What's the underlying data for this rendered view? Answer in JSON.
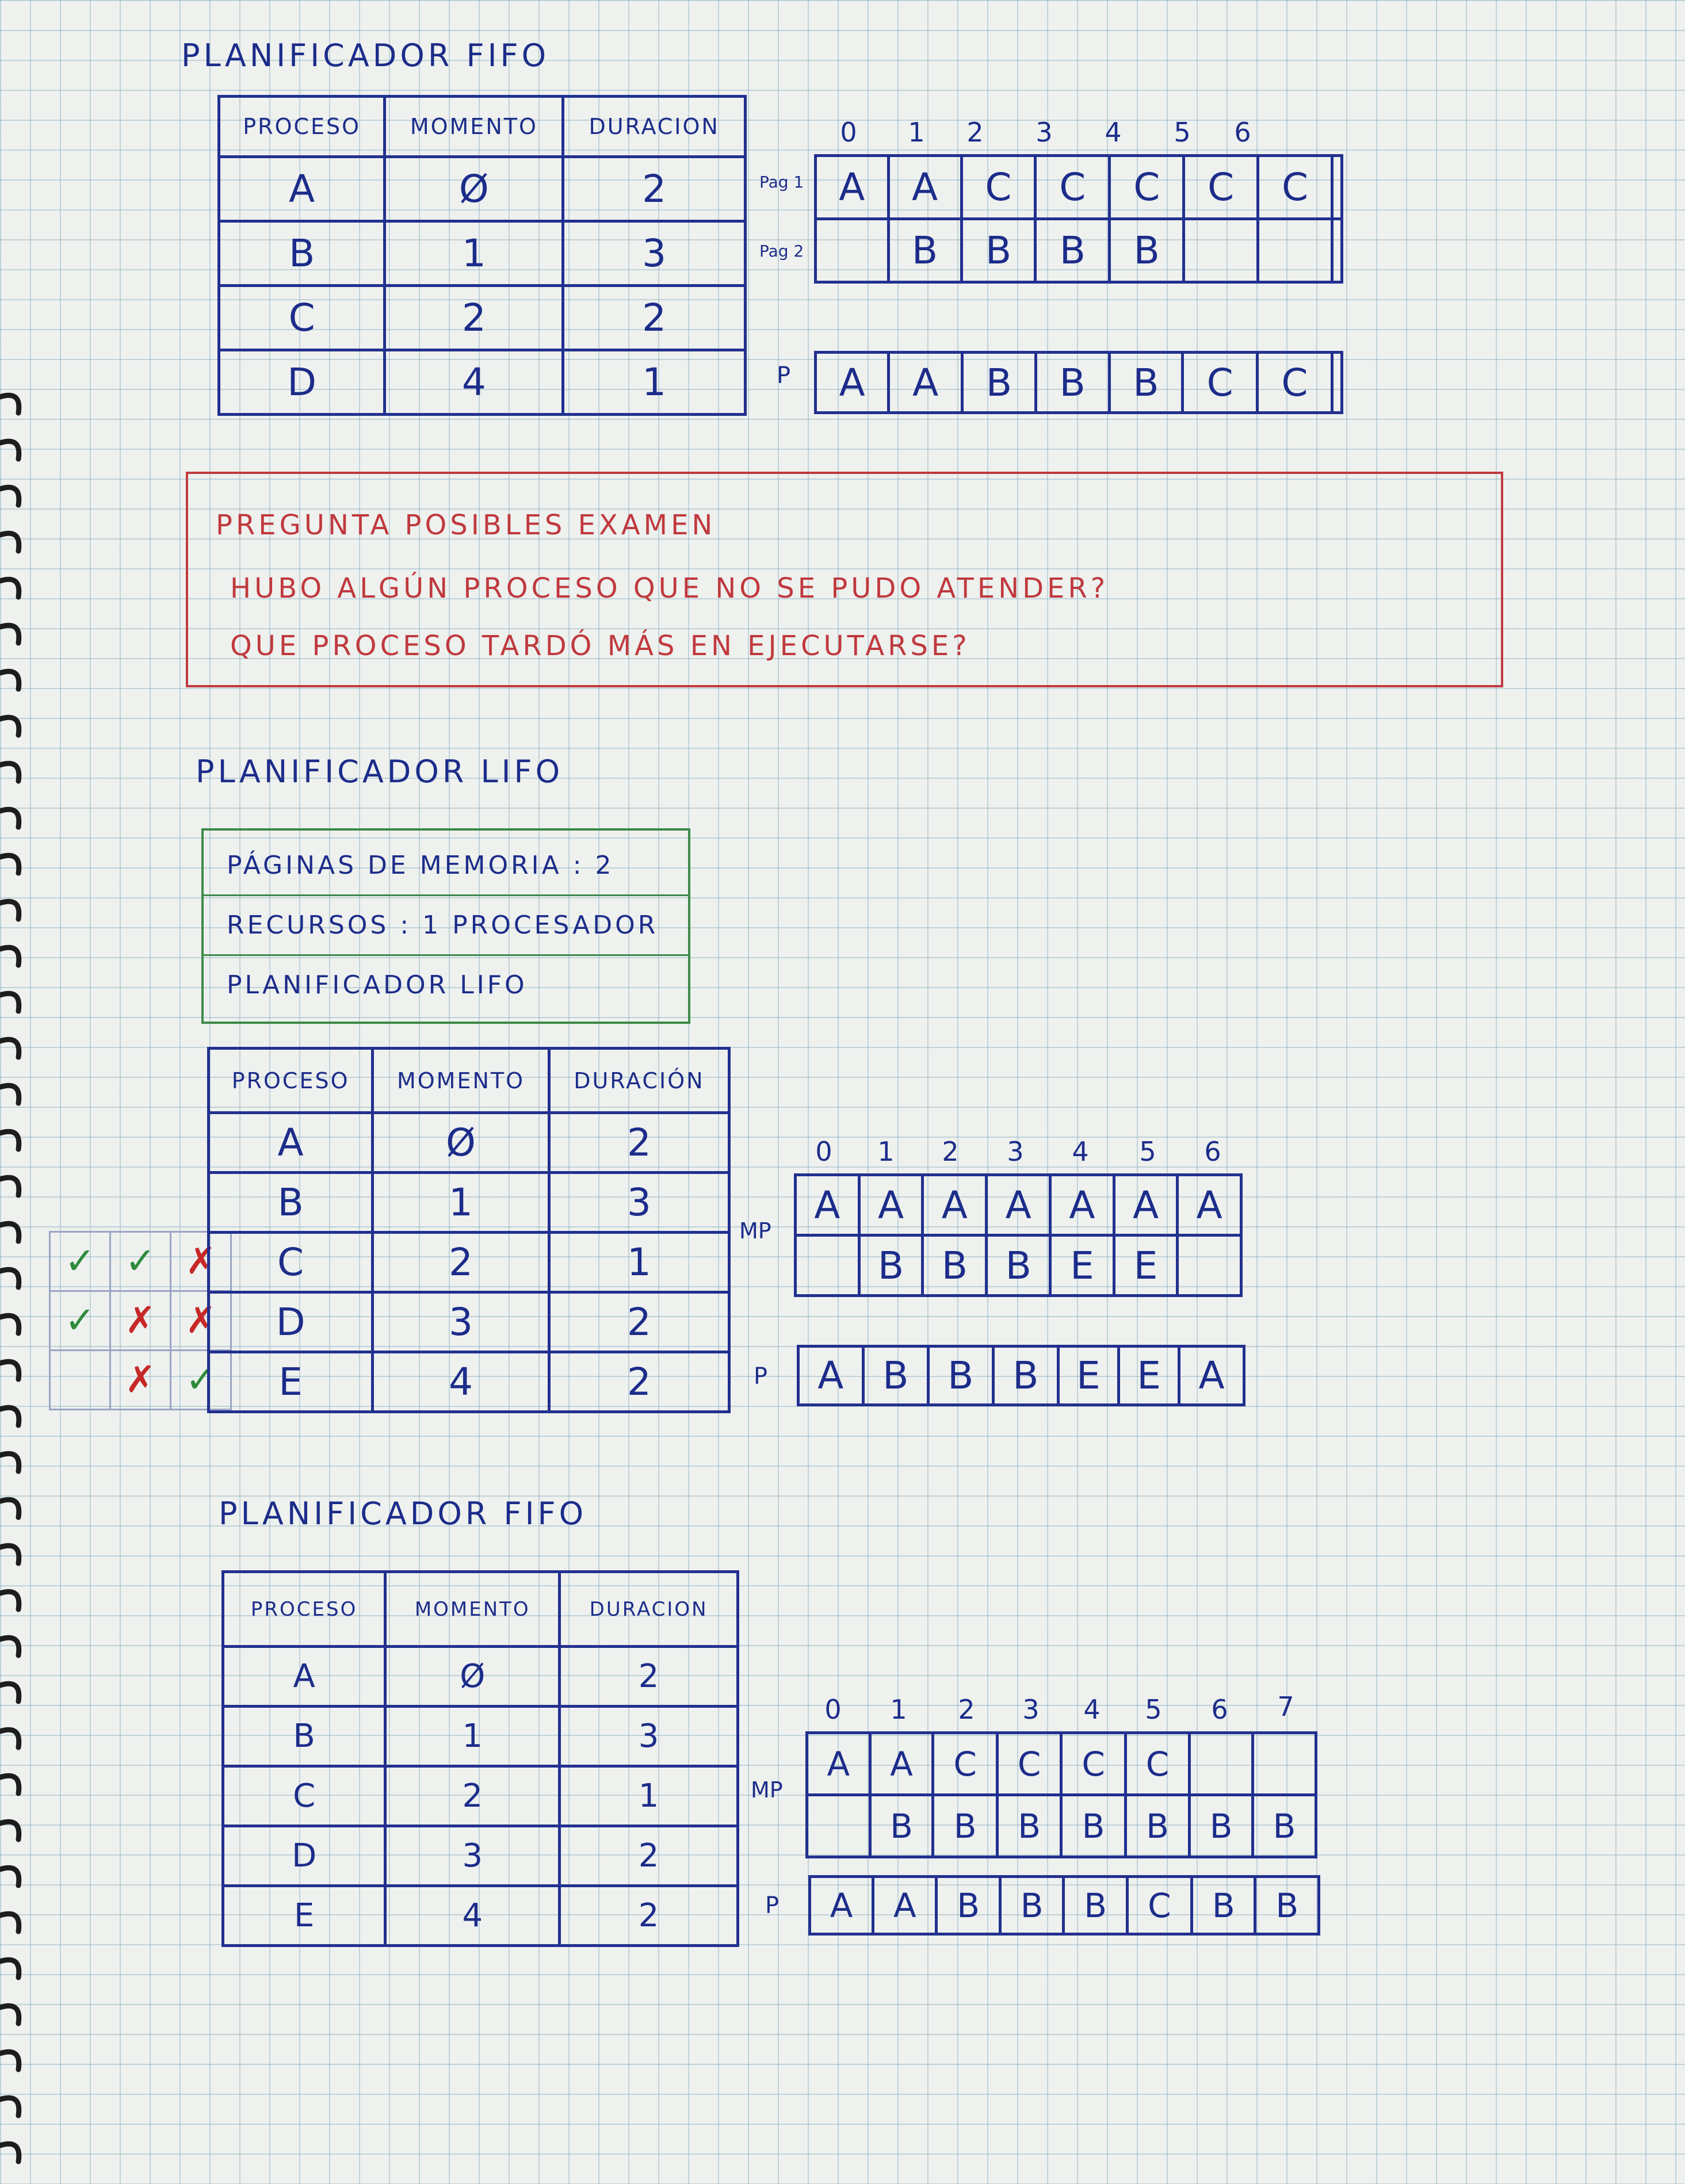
{
  "colors": {
    "ink_blue": "#1c2c8a",
    "ink_red": "#c0393e",
    "ink_green": "#3c8a4a",
    "check_green": "#2e8b3a",
    "cross_red": "#c62828"
  },
  "section1": {
    "title": "PLANIFICADOR FIFO",
    "headers": [
      "PROCESO",
      "MOMENTO",
      "DURACION"
    ],
    "rows": [
      [
        "A",
        "Ø",
        "2"
      ],
      [
        "B",
        "1",
        "3"
      ],
      [
        "C",
        "2",
        "2"
      ],
      [
        "D",
        "4",
        "1"
      ]
    ],
    "timeline_ticks": [
      "0",
      "1",
      "2",
      "3",
      "4",
      "5",
      "6"
    ],
    "page_labels": [
      "Pag 1",
      "Pag 2"
    ],
    "memory_rows": [
      [
        "A",
        "A",
        "C",
        "C",
        "C",
        "C",
        "C",
        ""
      ],
      [
        "",
        "B",
        "B",
        "B",
        "B",
        "",
        "",
        ""
      ]
    ],
    "processor_label": "P",
    "processor_row": [
      "A",
      "A",
      "B",
      "B",
      "B",
      "C",
      "C",
      ""
    ]
  },
  "question_box": {
    "heading": "PREGUNTA POSIBLES EXAMEN",
    "line1": "HUBO ALGÚN PROCESO QUE NO SE PUDO ATENDER?",
    "line2": "QUE PROCESO TARDÓ MÁS EN EJECUTARSE?"
  },
  "section2": {
    "title": "PLANIFICADOR LIFO",
    "config": [
      "PÁGINAS DE MEMORIA : 2",
      "RECURSOS : 1 PROCESADOR",
      "PLANIFICADOR LIFO"
    ],
    "headers": [
      "PROCESO",
      "MOMENTO",
      "DURACIÓN"
    ],
    "rows": [
      [
        "A",
        "Ø",
        "2"
      ],
      [
        "B",
        "1",
        "3"
      ],
      [
        "C",
        "2",
        "1"
      ],
      [
        "D",
        "3",
        "2"
      ],
      [
        "E",
        "4",
        "2"
      ]
    ],
    "checkmarks": [
      [
        "",
        "",
        ""
      ],
      [
        "",
        "",
        ""
      ],
      [
        "✓",
        "✓",
        "✗"
      ],
      [
        "✓",
        "✗",
        "✗"
      ],
      [
        "",
        "✗",
        "✓"
      ]
    ],
    "timeline_ticks": [
      "0",
      "1",
      "2",
      "3",
      "4",
      "5",
      "6"
    ],
    "memory_label": "MP",
    "memory_rows": [
      [
        "A",
        "A",
        "A",
        "A",
        "A",
        "A",
        "A"
      ],
      [
        "",
        "B",
        "B",
        "B",
        "E",
        "E",
        ""
      ]
    ],
    "processor_label": "P",
    "processor_row": [
      "A",
      "B",
      "B",
      "B",
      "E",
      "E",
      "A"
    ]
  },
  "section3": {
    "title": "PLANIFICADOR FIFO",
    "headers": [
      "PROCESO",
      "MOMENTO",
      "DURACION"
    ],
    "rows": [
      [
        "A",
        "Ø",
        "2"
      ],
      [
        "B",
        "1",
        "3"
      ],
      [
        "C",
        "2",
        "1"
      ],
      [
        "D",
        "3",
        "2"
      ],
      [
        "E",
        "4",
        "2"
      ]
    ],
    "timeline_ticks": [
      "0",
      "1",
      "2",
      "3",
      "4",
      "5",
      "6",
      "7"
    ],
    "memory_label": "MP",
    "memory_rows": [
      [
        "A",
        "A",
        "C",
        "C",
        "C",
        "C",
        "",
        ""
      ],
      [
        "",
        "B",
        "B",
        "B",
        "B",
        "B",
        "B",
        "B"
      ]
    ],
    "processor_label": "P",
    "processor_row": [
      "A",
      "A",
      "B",
      "B",
      "B",
      "C",
      "B",
      "B"
    ]
  }
}
